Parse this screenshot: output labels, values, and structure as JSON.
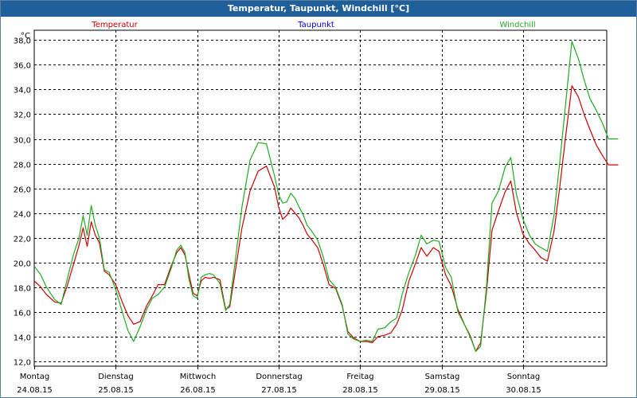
{
  "window": {
    "title": "Temperatur, Taupunkt, Windchill [°C]"
  },
  "chart_data": {
    "type": "line",
    "ylabel": "°C",
    "ylim": [
      11.6,
      38.8
    ],
    "yticks": [
      12.0,
      14.0,
      16.0,
      18.0,
      20.0,
      22.0,
      24.0,
      26.0,
      28.0,
      30.0,
      32.0,
      34.0,
      36.0,
      38.0
    ],
    "ytick_labels": [
      "12,0",
      "14,0",
      "16,0",
      "18,0",
      "20,0",
      "22,0",
      "24,0",
      "26,0",
      "28,0",
      "30,0",
      "32,0",
      "34,0",
      "36,0",
      "38,0"
    ],
    "xlim": [
      0,
      7.17
    ],
    "day_labels": [
      {
        "day": "Montag",
        "date": "24.08.15"
      },
      {
        "day": "Dienstag",
        "date": "25.08.15"
      },
      {
        "day": "Mittwoch",
        "date": "26.08.15"
      },
      {
        "day": "Donnerstag",
        "date": "27.08.15"
      },
      {
        "day": "Freitag",
        "date": "28.08.15"
      },
      {
        "day": "Samstag",
        "date": "29.08.15"
      },
      {
        "day": "Sonntag",
        "date": "30.08.15"
      }
    ],
    "grid": true,
    "series": [
      {
        "name": "Temperatur",
        "color": "#cc0000",
        "x": [
          0.0,
          0.08,
          0.15,
          0.25,
          0.33,
          0.4,
          0.48,
          0.55,
          0.6,
          0.65,
          0.7,
          0.75,
          0.8,
          0.86,
          0.92,
          1.0,
          1.08,
          1.15,
          1.22,
          1.3,
          1.38,
          1.45,
          1.52,
          1.6,
          1.68,
          1.75,
          1.8,
          1.85,
          1.9,
          1.95,
          2.0,
          2.05,
          2.1,
          2.15,
          2.2,
          2.28,
          2.35,
          2.4,
          2.45,
          2.55,
          2.65,
          2.75,
          2.85,
          2.95,
          3.0,
          3.05,
          3.1,
          3.15,
          3.2,
          3.25,
          3.3,
          3.35,
          3.4,
          3.48,
          3.55,
          3.62,
          3.7,
          3.78,
          3.85,
          3.92,
          4.0,
          4.08,
          4.15,
          4.22,
          4.3,
          4.38,
          4.45,
          4.52,
          4.6,
          4.68,
          4.75,
          4.82,
          4.9,
          4.97,
          5.05,
          5.12,
          5.2,
          5.28,
          5.35,
          5.42,
          5.48,
          5.55,
          5.62,
          5.7,
          5.78,
          5.85,
          5.92,
          6.0,
          6.08,
          6.15,
          6.22,
          6.3,
          6.38,
          6.45,
          6.52,
          6.6,
          6.68,
          6.75,
          6.82,
          6.9,
          6.98,
          7.05,
          7.12,
          7.17
        ],
        "y": [
          18.5,
          18.0,
          17.4,
          16.8,
          16.7,
          18.0,
          19.8,
          21.4,
          22.8,
          21.3,
          23.3,
          22.2,
          21.6,
          19.3,
          19.0,
          18.2,
          16.8,
          15.7,
          15.0,
          15.2,
          16.5,
          17.3,
          18.2,
          18.2,
          19.7,
          20.8,
          21.2,
          20.6,
          19.0,
          17.5,
          17.3,
          18.5,
          18.8,
          18.7,
          18.8,
          18.6,
          16.2,
          16.4,
          18.5,
          22.8,
          25.8,
          27.4,
          27.8,
          26.1,
          24.5,
          23.5,
          23.8,
          24.4,
          24.0,
          23.6,
          23.0,
          22.3,
          21.9,
          21.2,
          19.8,
          18.2,
          17.9,
          16.5,
          14.4,
          13.9,
          13.6,
          13.6,
          13.5,
          14.0,
          14.1,
          14.3,
          15.0,
          16.2,
          18.5,
          19.9,
          21.2,
          20.5,
          21.2,
          20.9,
          19.0,
          18.1,
          16.2,
          15.0,
          14.1,
          12.8,
          13.5,
          17.5,
          22.6,
          24.2,
          25.7,
          26.6,
          24.0,
          22.3,
          21.5,
          21.0,
          20.4,
          20.1,
          22.5,
          26.0,
          30.0,
          34.3,
          33.4,
          32.0,
          30.8,
          29.5,
          28.6,
          27.9,
          27.9,
          27.9
        ]
      },
      {
        "name": "Taupunkt",
        "color": "#0000cc",
        "x": [],
        "y": []
      },
      {
        "name": "Windchill",
        "color": "#22aa22",
        "x": [
          0.0,
          0.08,
          0.15,
          0.25,
          0.33,
          0.4,
          0.48,
          0.55,
          0.6,
          0.65,
          0.7,
          0.75,
          0.8,
          0.86,
          0.92,
          1.0,
          1.08,
          1.15,
          1.22,
          1.3,
          1.38,
          1.45,
          1.52,
          1.6,
          1.68,
          1.75,
          1.8,
          1.85,
          1.9,
          1.95,
          2.0,
          2.05,
          2.1,
          2.15,
          2.2,
          2.28,
          2.35,
          2.4,
          2.45,
          2.55,
          2.65,
          2.75,
          2.85,
          2.95,
          3.0,
          3.05,
          3.1,
          3.15,
          3.2,
          3.25,
          3.3,
          3.35,
          3.4,
          3.48,
          3.55,
          3.62,
          3.7,
          3.78,
          3.85,
          3.92,
          4.0,
          4.08,
          4.15,
          4.22,
          4.3,
          4.38,
          4.45,
          4.52,
          4.6,
          4.68,
          4.75,
          4.82,
          4.9,
          4.97,
          5.05,
          5.12,
          5.2,
          5.28,
          5.35,
          5.42,
          5.48,
          5.55,
          5.62,
          5.7,
          5.78,
          5.85,
          5.92,
          6.0,
          6.08,
          6.15,
          6.22,
          6.3,
          6.38,
          6.45,
          6.52,
          6.6,
          6.68,
          6.75,
          6.82,
          6.9,
          6.98,
          7.05,
          7.12,
          7.17
        ],
        "y": [
          19.7,
          19.0,
          18.0,
          17.0,
          16.6,
          18.5,
          20.6,
          22.0,
          23.8,
          22.2,
          24.6,
          23.0,
          22.0,
          19.4,
          19.2,
          17.8,
          16.0,
          14.5,
          13.6,
          14.8,
          16.2,
          17.1,
          17.4,
          18.0,
          19.5,
          21.0,
          21.4,
          20.8,
          18.6,
          17.3,
          17.1,
          18.8,
          19.0,
          19.1,
          19.0,
          18.3,
          16.1,
          16.6,
          19.2,
          24.5,
          28.3,
          29.7,
          29.6,
          27.0,
          25.5,
          24.8,
          24.9,
          25.6,
          25.2,
          24.5,
          23.9,
          23.0,
          22.6,
          21.8,
          20.4,
          18.6,
          18.0,
          16.6,
          14.2,
          13.8,
          13.6,
          13.7,
          13.6,
          14.6,
          14.7,
          15.2,
          15.5,
          17.5,
          19.2,
          20.6,
          22.2,
          21.5,
          21.8,
          21.7,
          19.6,
          18.8,
          16.0,
          15.0,
          14.0,
          12.8,
          13.2,
          17.9,
          24.8,
          25.8,
          27.7,
          28.5,
          25.5,
          23.5,
          22.2,
          21.5,
          21.2,
          20.9,
          23.8,
          28.0,
          32.6,
          37.9,
          36.5,
          34.8,
          33.3,
          32.3,
          31.2,
          30.0,
          30.0,
          30.0
        ]
      }
    ]
  }
}
